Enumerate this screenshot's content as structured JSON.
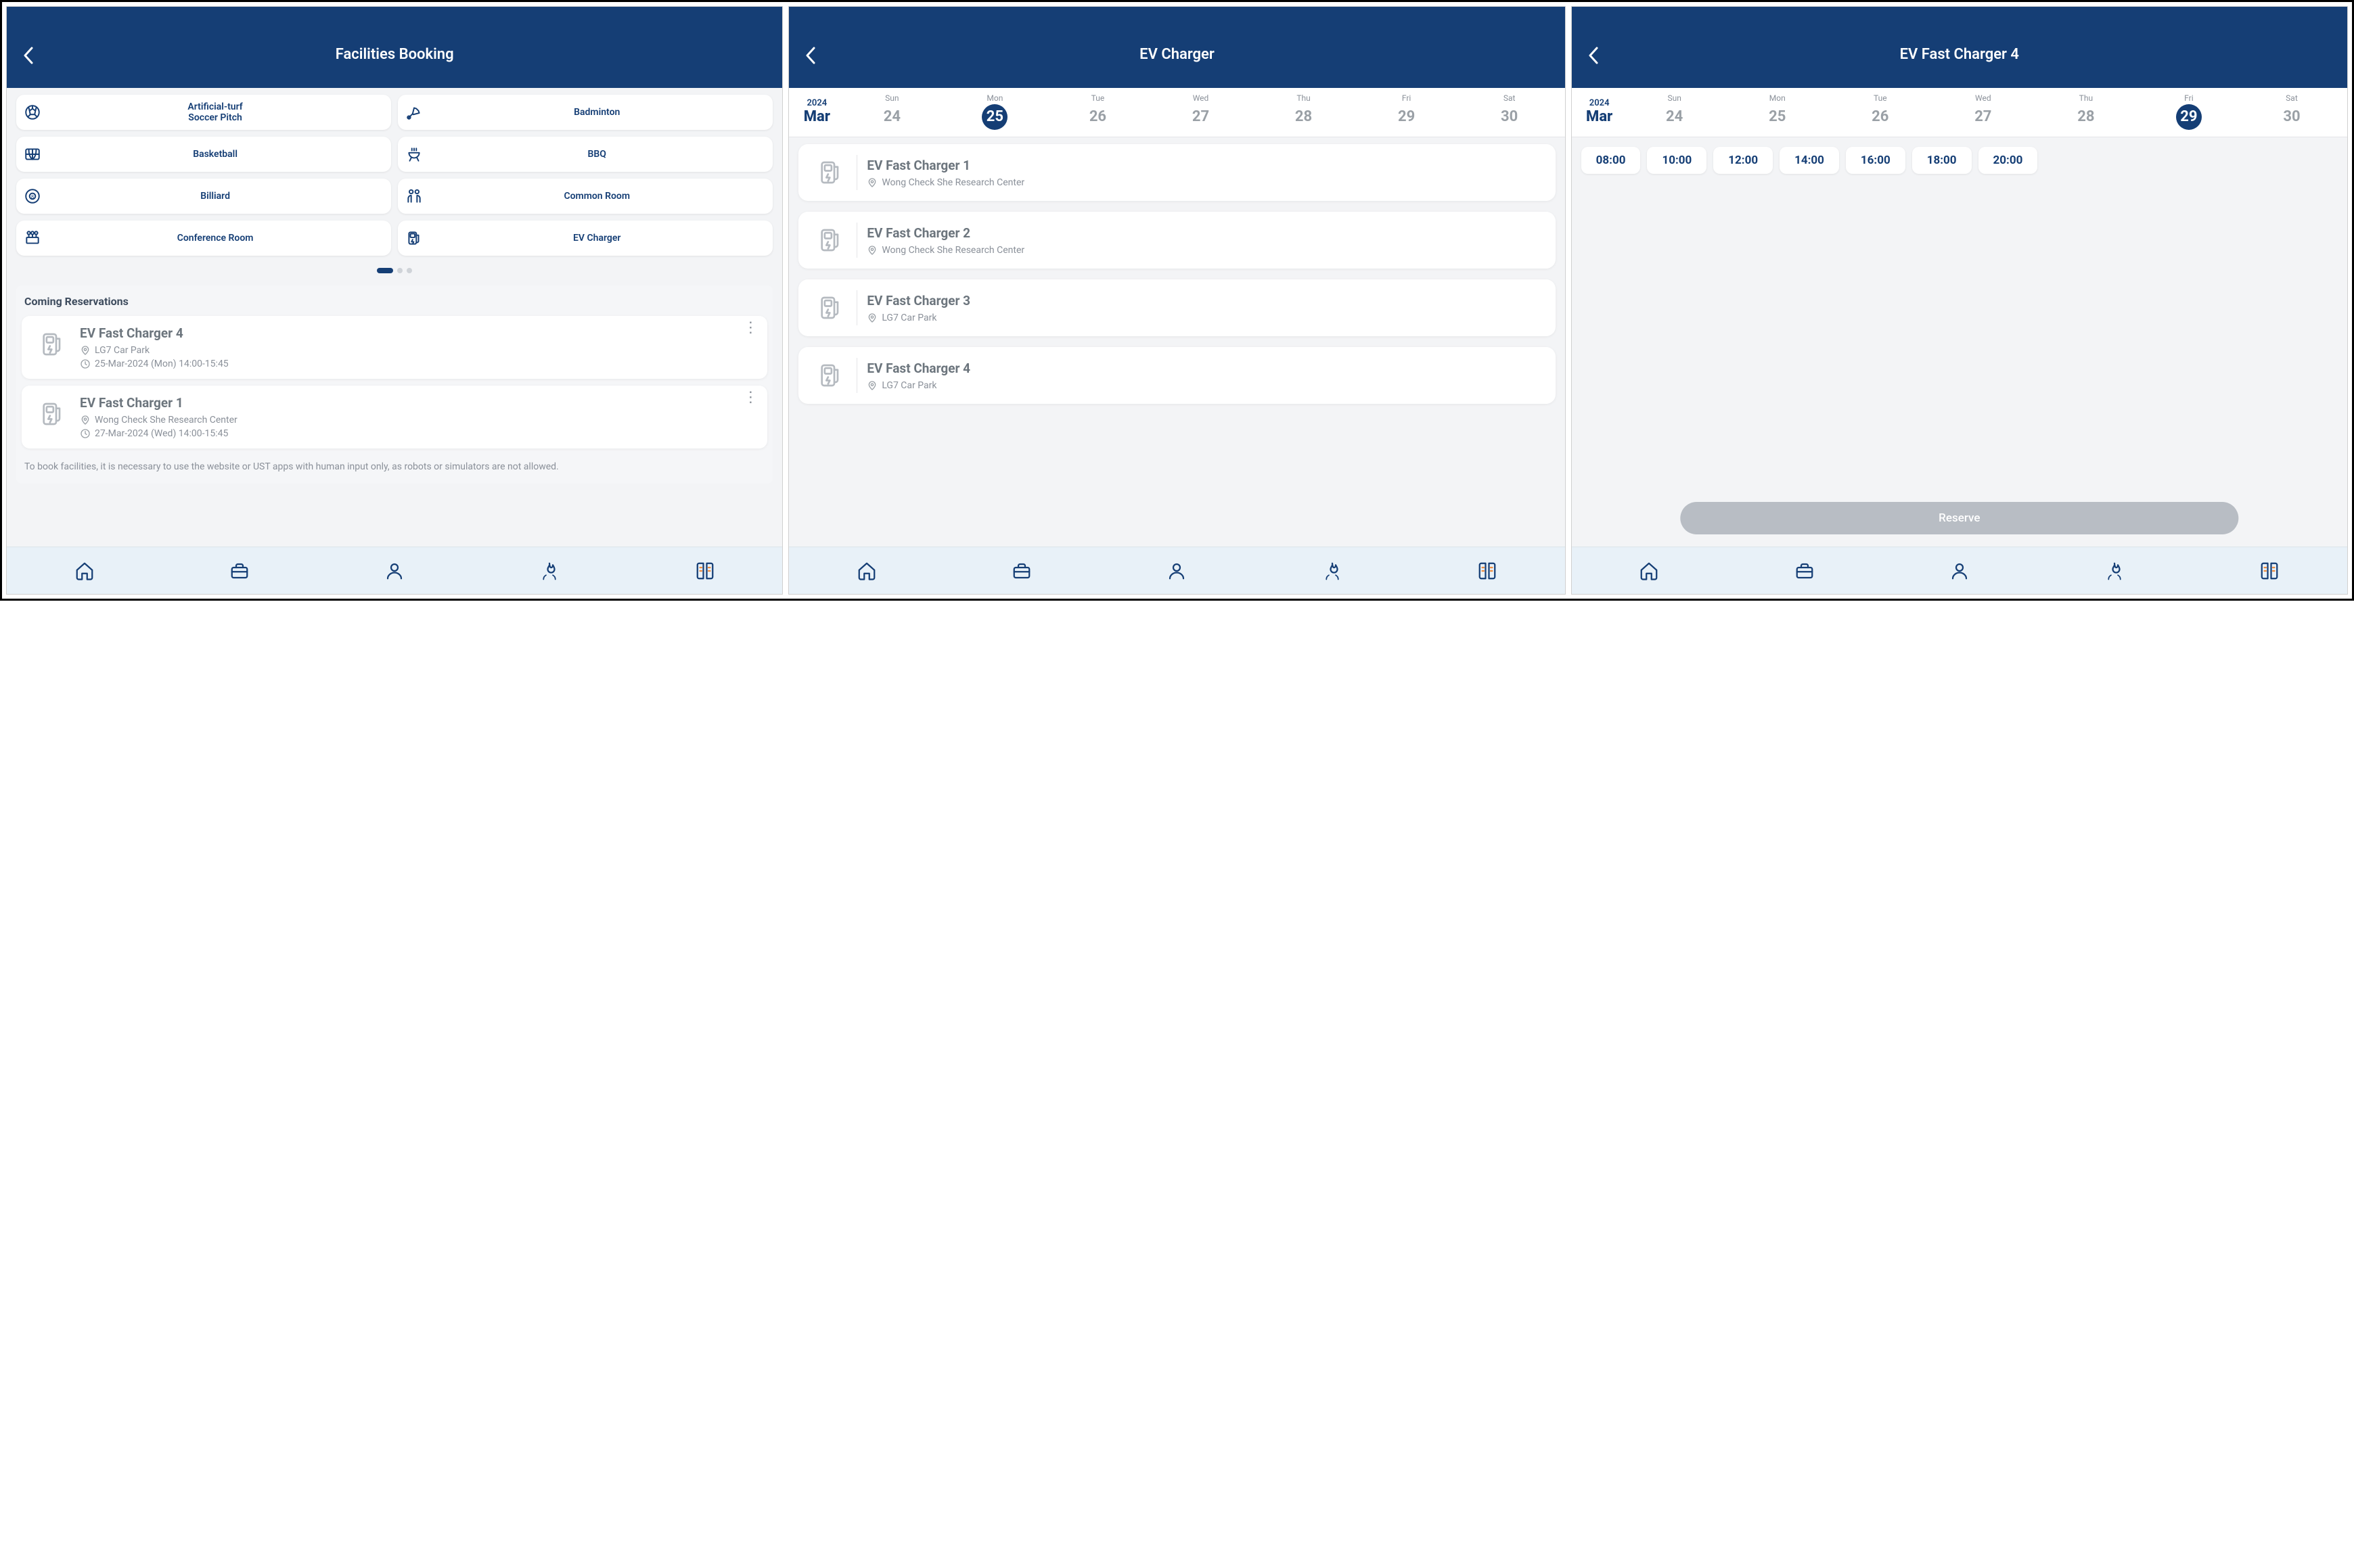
{
  "screen1": {
    "title": "Facilities Booking",
    "facilities": [
      {
        "label": "Artificial-turf Soccer Pitch",
        "icon": "soccer"
      },
      {
        "label": "Badminton",
        "icon": "badminton"
      },
      {
        "label": "Basketball",
        "icon": "basketball"
      },
      {
        "label": "BBQ",
        "icon": "bbq"
      },
      {
        "label": "Billiard",
        "icon": "billiard"
      },
      {
        "label": "Common Room",
        "icon": "commonroom"
      },
      {
        "label": "Conference Room",
        "icon": "conference"
      },
      {
        "label": "EV Charger",
        "icon": "evcharger"
      }
    ],
    "pager": {
      "count": 3,
      "active": 0
    },
    "coming_title": "Coming Reservations",
    "reservations": [
      {
        "name": "EV Fast Charger 4",
        "location": "LG7 Car Park",
        "time": "25-Mar-2024 (Mon) 14:00-15:45"
      },
      {
        "name": "EV Fast Charger 1",
        "location": "Wong Check She Research Center",
        "time": "27-Mar-2024 (Wed) 14:00-15:45"
      }
    ],
    "note": "To book facilities, it is necessary to use the website or UST apps with human input only, as robots or simulators are not allowed."
  },
  "screen2": {
    "title": "EV Charger",
    "year": "2024",
    "month": "Mar",
    "days": [
      {
        "dow": "Sun",
        "num": "24"
      },
      {
        "dow": "Mon",
        "num": "25",
        "selected": true
      },
      {
        "dow": "Tue",
        "num": "26"
      },
      {
        "dow": "Wed",
        "num": "27"
      },
      {
        "dow": "Thu",
        "num": "28"
      },
      {
        "dow": "Fri",
        "num": "29"
      },
      {
        "dow": "Sat",
        "num": "30"
      }
    ],
    "chargers": [
      {
        "name": "EV Fast Charger 1",
        "location": "Wong Check She Research Center"
      },
      {
        "name": "EV Fast Charger 2",
        "location": "Wong Check She Research Center"
      },
      {
        "name": "EV Fast Charger 3",
        "location": "LG7 Car Park"
      },
      {
        "name": "EV Fast Charger 4",
        "location": "LG7 Car Park"
      }
    ]
  },
  "screen3": {
    "title": "EV Fast Charger 4",
    "year": "2024",
    "month": "Mar",
    "days": [
      {
        "dow": "Sun",
        "num": "24"
      },
      {
        "dow": "Mon",
        "num": "25"
      },
      {
        "dow": "Tue",
        "num": "26"
      },
      {
        "dow": "Wed",
        "num": "27"
      },
      {
        "dow": "Thu",
        "num": "28"
      },
      {
        "dow": "Fri",
        "num": "29",
        "selected": true
      },
      {
        "dow": "Sat",
        "num": "30"
      }
    ],
    "slots": [
      "08:00",
      "10:00",
      "12:00",
      "14:00",
      "16:00",
      "18:00",
      "20:00"
    ],
    "reserve_label": "Reserve"
  },
  "bottombar_icons": [
    "home",
    "briefcase",
    "profile",
    "flame",
    "book"
  ]
}
